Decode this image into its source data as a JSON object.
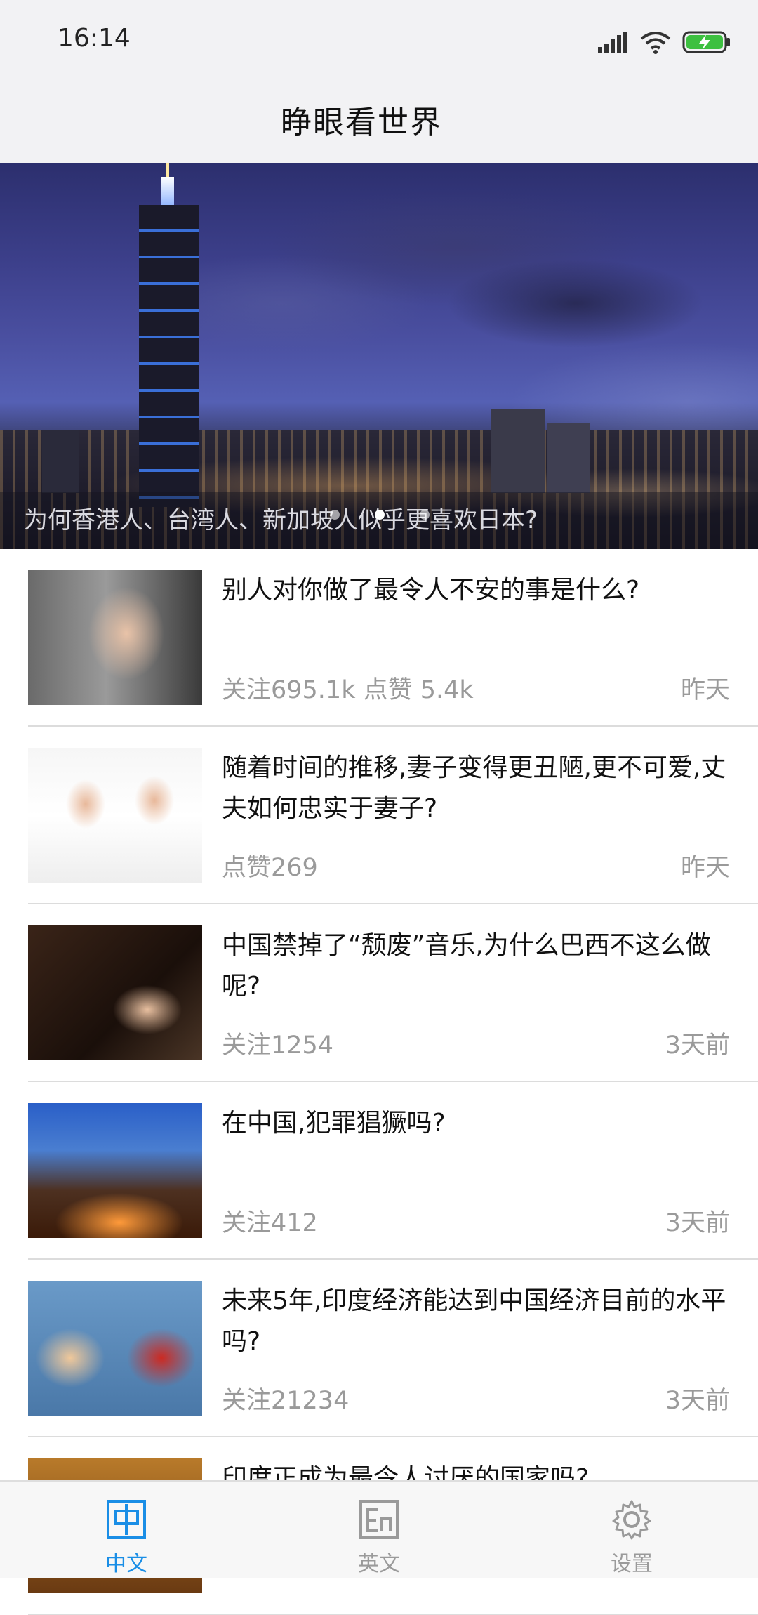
{
  "status_bar": {
    "time": "16:14",
    "icons": [
      "signal-icon",
      "wifi-icon",
      "battery-charging-icon"
    ]
  },
  "header": {
    "title": "睁眼看世界"
  },
  "banner": {
    "caption": "为何香港人、台湾人、新加坡人似乎更喜欢日本?",
    "dot_count": 3,
    "active_dot": 1
  },
  "news": [
    {
      "title": "别人对你做了最令人不安的事是什么?",
      "meta": "关注695.1k 点赞 5.4k",
      "time": "昨天"
    },
    {
      "title": "随着时间的推移,妻子变得更丑陋,更不可爱,丈夫如何忠实于妻子?",
      "meta": "点赞269",
      "time": "昨天"
    },
    {
      "title": "中国禁掉了“颓废”音乐,为什么巴西不这么做呢?",
      "meta": "关注1254",
      "time": "3天前"
    },
    {
      "title": "在中国,犯罪猖獗吗?",
      "meta": "关注412",
      "time": "3天前"
    },
    {
      "title": "未来5年,印度经济能达到中国经济目前的水平吗?",
      "meta": "关注21234",
      "time": "3天前"
    },
    {
      "title": "印度正成为最令人讨厌的国家吗?",
      "meta": "",
      "time": ""
    }
  ],
  "bottom_nav": {
    "items": [
      {
        "label": "中文",
        "icon": "chinese-tab-icon",
        "active": true
      },
      {
        "label": "英文",
        "icon": "english-tab-icon",
        "active": false
      },
      {
        "label": "设置",
        "icon": "gear-icon",
        "active": false
      }
    ],
    "active_color": "#1a8ee6",
    "inactive_color": "#9a9a9a"
  }
}
